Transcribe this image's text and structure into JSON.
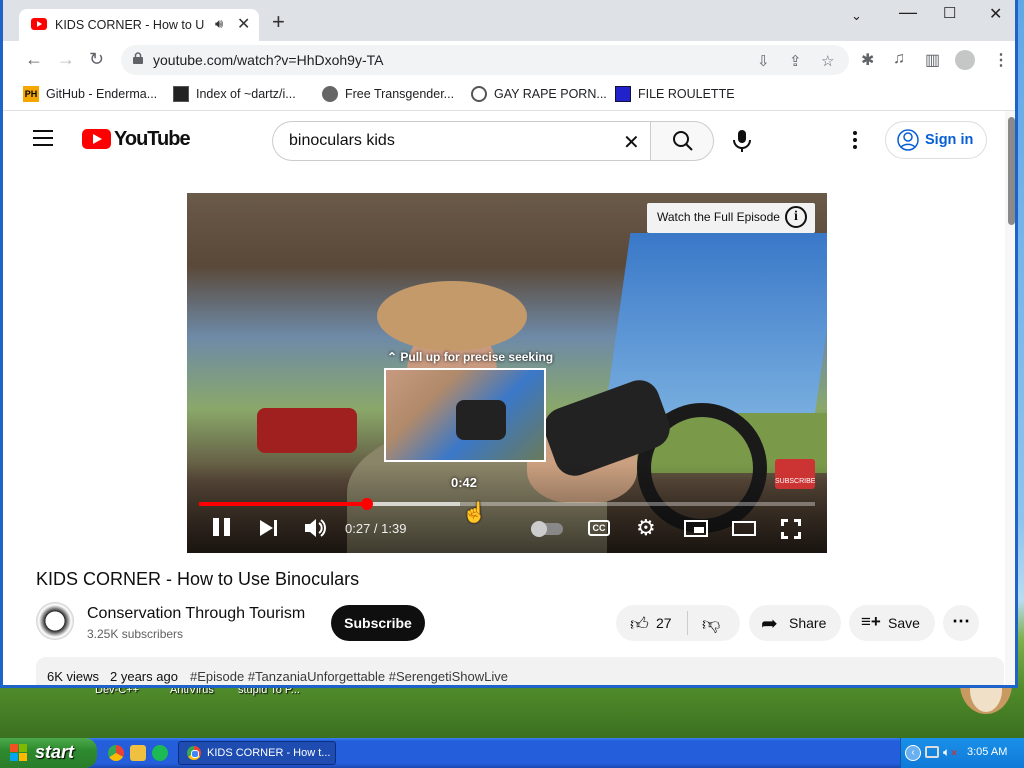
{
  "browser": {
    "tab_title": "KIDS CORNER - How to Use Binoculars",
    "url": "youtube.com/watch?v=HhDxoh9y-TA",
    "bookmarks": [
      {
        "label": "GitHub - Enderma..."
      },
      {
        "label": "Index of ~dartz/i..."
      },
      {
        "label": "Free Transgender..."
      },
      {
        "label": "GAY RAPE PORN..."
      },
      {
        "label": "FILE ROULETTE"
      }
    ]
  },
  "youtube": {
    "logo_text": "YouTube",
    "search_value": "binoculars kids",
    "signin_label": "Sign in"
  },
  "player": {
    "full_episode_label": "Watch the Full Episode",
    "pull_up_hint": "⌃ Pull up for precise seeking",
    "seek_preview_time": "0:42",
    "time_display": "0:27 / 1:39",
    "progress_played": 0.2727,
    "progress_hover": 0.4242,
    "cc_label": "CC",
    "watermark_label": "SUBSCRIBE"
  },
  "video": {
    "title": "KIDS CORNER - How to Use Binoculars",
    "channel_name": "Conservation Through Tourism",
    "subscribers": "3.25K subscribers",
    "subscribe_label": "Subscribe",
    "like_count": "27",
    "share_label": "Share",
    "save_label": "Save",
    "views": "6K views",
    "date": "2 years ago",
    "tags": "#Episode #TanzaniaUnforgettable #SerengetiShowLive"
  },
  "desktop": {
    "icon_labels": [
      "Dev-C++",
      "AntiVirus",
      "stupid To P..."
    ]
  },
  "taskbar": {
    "start_label": "start",
    "window_label": "KIDS CORNER - How t...",
    "clock": "3:05 AM"
  }
}
